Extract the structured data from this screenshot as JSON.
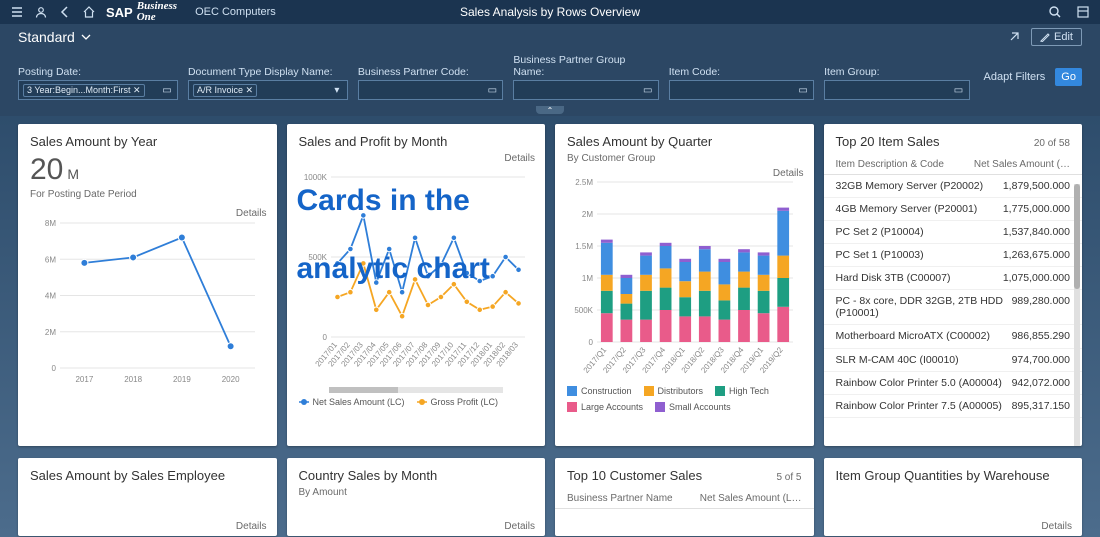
{
  "topbar": {
    "company": "OEC Computers",
    "page_title": "Sales Analysis by Rows Overview",
    "logo_main": "SAP",
    "logo_sub1": "Business",
    "logo_sub2": "One"
  },
  "variant": {
    "name": "Standard",
    "edit": "Edit"
  },
  "filters": {
    "posting_date": {
      "label": "Posting Date:",
      "token": "3 Year:Begin...Month:First ✕"
    },
    "doc_type": {
      "label": "Document Type Display Name:",
      "token": "A/R Invoice ✕"
    },
    "bp_code": {
      "label": "Business Partner Code:"
    },
    "bp_group": {
      "label": "Business Partner Group Name:"
    },
    "item_code": {
      "label": "Item Code:"
    },
    "item_group": {
      "label": "Item Group:"
    },
    "adapt": "Adapt Filters",
    "go": "Go"
  },
  "cards": {
    "year": {
      "title": "Sales Amount by Year",
      "kpi_value": "20",
      "kpi_unit": "M",
      "kpi_sub": "For Posting Date Period",
      "details": "Details"
    },
    "month": {
      "title": "Sales and Profit by Month",
      "details": "Details",
      "legend": [
        "Net Sales Amount (LC)",
        "Gross Profit (LC)"
      ]
    },
    "quarter": {
      "title": "Sales Amount by Quarter",
      "sub": "By Customer Group",
      "details": "Details",
      "legend": [
        "Construction",
        "Distributors",
        "High Tech",
        "Large Accounts",
        "Small Accounts"
      ]
    },
    "topitems": {
      "title": "Top 20 Item Sales",
      "counter": "20 of 58",
      "col1": "Item Description & Code",
      "col2": "Net Sales Amount (…",
      "rows": [
        {
          "desc": "32GB Memory Server (P20002)",
          "val": "1,879,500.000"
        },
        {
          "desc": "4GB Memory Server (P20001)",
          "val": "1,775,000.000"
        },
        {
          "desc": "PC Set 2 (P10004)",
          "val": "1,537,840.000"
        },
        {
          "desc": "PC Set 1 (P10003)",
          "val": "1,263,675.000"
        },
        {
          "desc": "Hard Disk 3TB (C00007)",
          "val": "1,075,000.000"
        },
        {
          "desc": "PC - 8x core, DDR 32GB, 2TB HDD (P10001)",
          "val": "989,280.000"
        },
        {
          "desc": "Motherboard MicroATX (C00002)",
          "val": "986,855.290"
        },
        {
          "desc": "SLR M-CAM 40C (I00010)",
          "val": "974,700.000"
        },
        {
          "desc": "Rainbow Color Printer 5.0 (A00004)",
          "val": "942,072.000"
        },
        {
          "desc": "Rainbow Color Printer 7.5 (A00005)",
          "val": "895,317.150"
        }
      ]
    },
    "emp": {
      "title": "Sales Amount by Sales Employee",
      "details": "Details"
    },
    "country": {
      "title": "Country Sales by Month",
      "sub": "By Amount",
      "details": "Details"
    },
    "cust": {
      "title": "Top 10 Customer Sales",
      "counter": "5 of 5",
      "col1": "Business Partner Name",
      "col2": "Net Sales Amount (L…"
    },
    "wh": {
      "title": "Item Group Quantities by Warehouse",
      "details": "Details"
    }
  },
  "overlay": {
    "line1": "Cards in the",
    "line2": "analytic chart"
  },
  "chart_data": [
    {
      "id": "year_line",
      "type": "line",
      "title": "Sales Amount by Year",
      "ylabel": "",
      "ylim": [
        0,
        8000000
      ],
      "yticks": [
        0,
        2000000,
        4000000,
        6000000,
        8000000
      ],
      "ytick_labels": [
        "0",
        "2M",
        "4M",
        "6M",
        "8M"
      ],
      "categories": [
        "2017",
        "2018",
        "2019",
        "2020"
      ],
      "values": [
        5800000,
        6100000,
        7200000,
        1200000
      ]
    },
    {
      "id": "month_lines",
      "type": "line",
      "title": "Sales and Profit by Month",
      "ylim": [
        0,
        1000000
      ],
      "yticks": [
        0,
        500000,
        1000000
      ],
      "ytick_labels": [
        "0",
        "500K",
        "1000K"
      ],
      "categories": [
        "2017/01",
        "2017/02",
        "2017/03",
        "2017/04",
        "2017/05",
        "2017/06",
        "2017/07",
        "2017/08",
        "2017/09",
        "2017/10",
        "2017/11",
        "2017/12",
        "2018/01",
        "2018/02",
        "2018/03"
      ],
      "series": [
        {
          "name": "Net Sales Amount (LC)",
          "color": "#2f7ed8",
          "values": [
            460000,
            550000,
            760000,
            340000,
            550000,
            280000,
            620000,
            380000,
            450000,
            620000,
            400000,
            350000,
            380000,
            500000,
            420000
          ]
        },
        {
          "name": "Gross Profit (LC)",
          "color": "#f5a623",
          "values": [
            250000,
            280000,
            460000,
            170000,
            280000,
            130000,
            360000,
            200000,
            250000,
            330000,
            220000,
            170000,
            190000,
            280000,
            210000
          ]
        }
      ]
    },
    {
      "id": "quarter_stack",
      "type": "bar",
      "stacked": true,
      "title": "Sales Amount by Quarter",
      "ylim": [
        0,
        2500000
      ],
      "yticks": [
        0,
        500000,
        1000000,
        1500000,
        2000000,
        2500000
      ],
      "ytick_labels": [
        "0",
        "500K",
        "1M",
        "1.5M",
        "2M",
        "2.5M"
      ],
      "categories": [
        "2017/Q1",
        "2017/Q2",
        "2017/Q3",
        "2017/Q4",
        "2018/Q1",
        "2018/Q2",
        "2018/Q3",
        "2018/Q4",
        "2019/Q1",
        "2019/Q2"
      ],
      "series": [
        {
          "name": "Construction",
          "color": "#3f8ee0",
          "values": [
            500000,
            250000,
            300000,
            350000,
            300000,
            350000,
            350000,
            300000,
            300000,
            700000
          ]
        },
        {
          "name": "Distributors",
          "color": "#f5a623",
          "values": [
            250000,
            150000,
            250000,
            300000,
            250000,
            300000,
            250000,
            250000,
            250000,
            350000
          ]
        },
        {
          "name": "High Tech",
          "color": "#1e9e82",
          "values": [
            350000,
            250000,
            450000,
            350000,
            300000,
            400000,
            300000,
            350000,
            350000,
            450000
          ]
        },
        {
          "name": "Large Accounts",
          "color": "#e95b8a",
          "values": [
            450000,
            350000,
            350000,
            500000,
            400000,
            400000,
            350000,
            500000,
            450000,
            550000
          ]
        },
        {
          "name": "Small Accounts",
          "color": "#8f5fd0",
          "values": [
            50000,
            50000,
            50000,
            50000,
            50000,
            50000,
            50000,
            50000,
            50000,
            50000
          ]
        }
      ],
      "legend_position": "bottom"
    }
  ],
  "colors": {
    "net_sales": "#2f7ed8",
    "gross_profit": "#f5a623",
    "construction": "#3f8ee0",
    "distributors": "#f5a623",
    "high_tech": "#1e9e82",
    "large_accounts": "#e95b8a",
    "small_accounts": "#8f5fd0"
  }
}
